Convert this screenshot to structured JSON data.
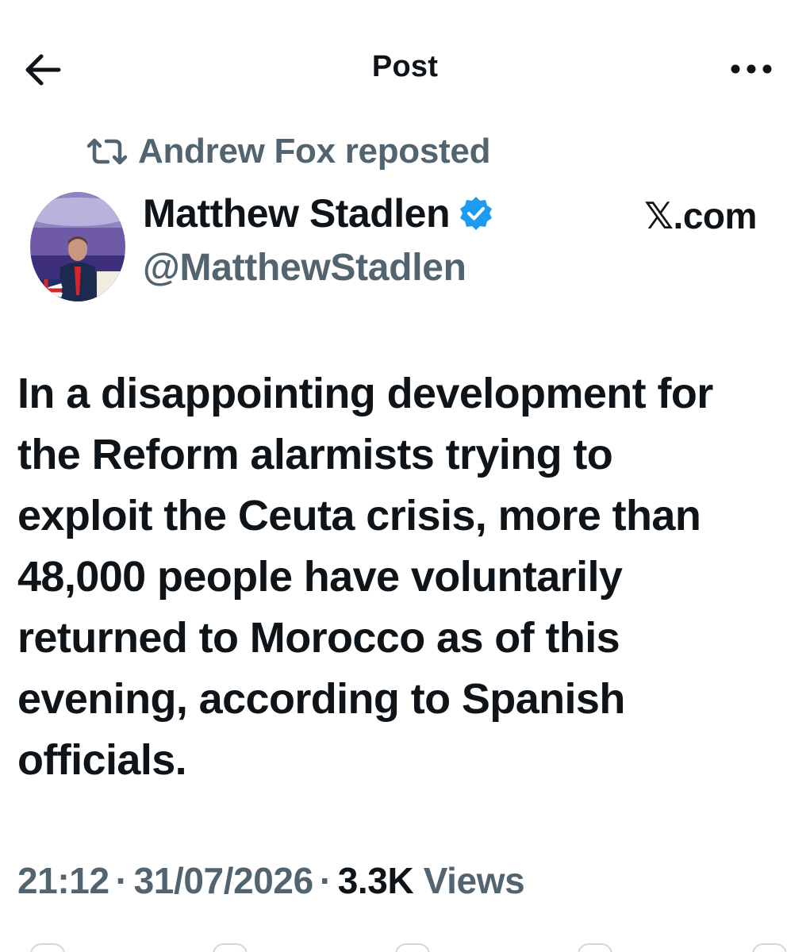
{
  "header": {
    "title": "Post",
    "back_icon": "arrow-left-icon",
    "more_icon": "more-horizontal-icon"
  },
  "repost": {
    "icon": "repost-icon",
    "text": "Andrew Fox reposted"
  },
  "author": {
    "name": "Matthew Stadlen",
    "handle": "@MatthewStadlen",
    "verified_icon": "verified-badge-icon",
    "verified_color": "#1d9bf0"
  },
  "source": "𝕏.com",
  "post": {
    "text": "In a disappointing development for\nthe Reform alarmists trying to\nexploit the Ceuta crisis, more than\n48,000 people have voluntarily\nreturned to Morocco as of this\nevening, according to Spanish\nofficials."
  },
  "meta": {
    "time": "21:12",
    "separator": "·",
    "date": "31/07/2026",
    "views_count": "3.3K",
    "views_label": "Views"
  },
  "colors": {
    "text": "#0f1419",
    "secondary": "#536471",
    "accent": "#1d9bf0"
  }
}
